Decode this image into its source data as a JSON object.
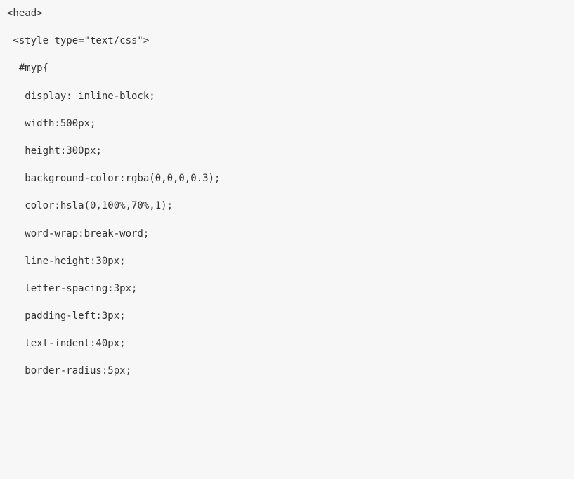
{
  "code": {
    "lines": [
      "<head>",
      "",
      " <style type=\"text/css\">",
      "",
      "  #myp{",
      "",
      "   display: inline-block;",
      "",
      "   width:500px;",
      "",
      "   height:300px;",
      "",
      "   background-color:rgba(0,0,0,0.3);",
      "",
      "   color:hsla(0,100%,70%,1);",
      "",
      "   word-wrap:break-word;",
      "",
      "   line-height:30px;",
      "",
      "   letter-spacing:3px;",
      "",
      "   padding-left:3px;",
      "",
      "   text-indent:40px;",
      "",
      "   border-radius:5px;"
    ]
  }
}
